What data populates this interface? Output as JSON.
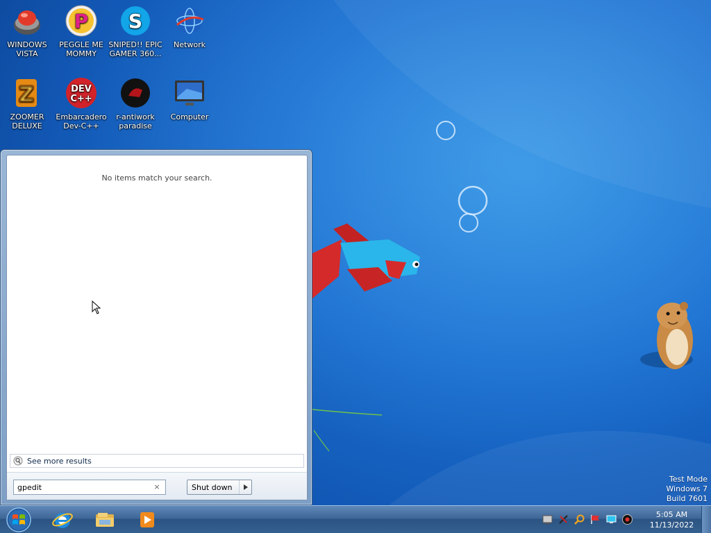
{
  "desktop": {
    "icons": [
      {
        "label": "WINDOWS VISTA",
        "icon": "vista-shell-icon"
      },
      {
        "label": "PEGGLE ME MOMMY",
        "icon": "peggle-icon"
      },
      {
        "label": "SNIPED!! EPIC GAMER 360...",
        "icon": "skype-icon"
      },
      {
        "label": "Network",
        "icon": "network-globe-icon"
      },
      {
        "label": "ZOOMER DELUXE",
        "icon": "zoomer-icon"
      },
      {
        "label": "Embarcadero Dev-C++",
        "icon": "devcpp-icon"
      },
      {
        "label": "r-antiwork paradise",
        "icon": "antiwork-icon"
      },
      {
        "label": "Computer",
        "icon": "computer-monitor-icon"
      }
    ]
  },
  "start_menu": {
    "no_results_text": "No items match your search.",
    "see_more_label": "See more results",
    "search": {
      "value": "gpedit",
      "clear_glyph": "×"
    },
    "shutdown_label": "Shut down"
  },
  "watermark": {
    "line1": "Test Mode",
    "line2": "Windows 7",
    "line3": "Build 7601"
  },
  "taskbar": {
    "pinned": [
      "internet-explorer-icon",
      "file-explorer-icon",
      "media-player-icon"
    ],
    "tray_icons": [
      "network-tray-icon",
      "tools-tray-icon",
      "search-tray-icon",
      "flag-tray-icon",
      "display-tray-icon",
      "volume-tray-icon"
    ],
    "clock": {
      "time": "5:05 AM",
      "date": "11/13/2022"
    }
  },
  "colors": {
    "desktop_blue": "#1b6fd0",
    "taskbar": "#3f6797",
    "accent_red": "#e03030"
  }
}
